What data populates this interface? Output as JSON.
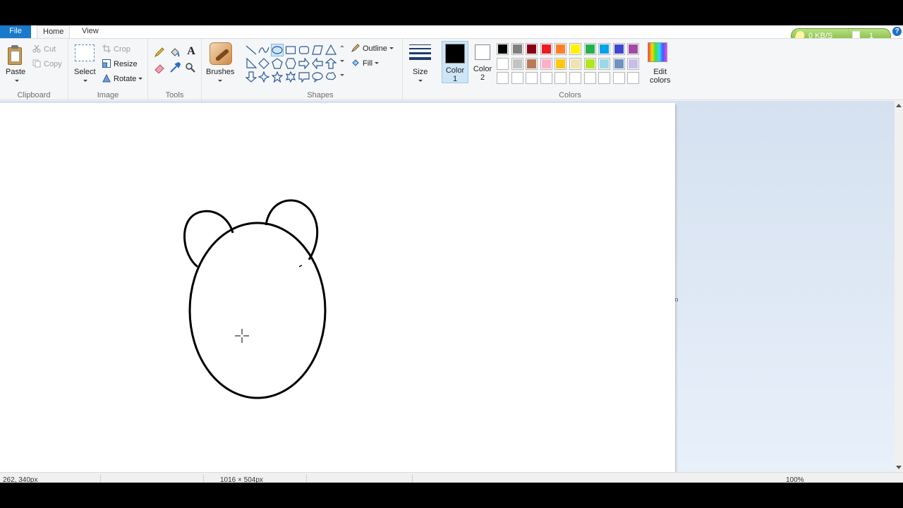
{
  "tabs": {
    "file": "File",
    "home": "Home",
    "view": "View"
  },
  "net_meter": {
    "speed": "0 KB/S",
    "count": "1"
  },
  "help": "?",
  "clipboard": {
    "paste": "Paste",
    "cut": "Cut",
    "copy": "Copy",
    "label": "Clipboard"
  },
  "image": {
    "select": "Select",
    "crop": "Crop",
    "resize": "Resize",
    "rotate": "Rotate",
    "label": "Image"
  },
  "tools": {
    "label": "Tools",
    "text_glyph": "A"
  },
  "brushes": {
    "label": "Brushes"
  },
  "shapes": {
    "outline": "Outline",
    "fill": "Fill",
    "label": "Shapes"
  },
  "size": {
    "label": "Size"
  },
  "colors": {
    "color1_label": "Color",
    "color1_num": "1",
    "color2_label": "Color",
    "color2_num": "2",
    "color1_value": "#000000",
    "color2_value": "#ffffff",
    "edit_label_1": "Edit",
    "edit_label_2": "colors",
    "label": "Colors",
    "palette_row1": [
      "#000000",
      "#7f7f7f",
      "#880015",
      "#ed1c24",
      "#ff7f27",
      "#fff200",
      "#22b14c",
      "#00a2e8",
      "#3f48cc",
      "#a349a4"
    ],
    "palette_row2": [
      "#ffffff",
      "#c3c3c3",
      "#b97a57",
      "#ffaec9",
      "#ffc90e",
      "#efe4b0",
      "#b5e61d",
      "#99d9ea",
      "#7092be",
      "#c8bfe7"
    ],
    "palette_row3": [
      "",
      "",
      "",
      "",
      "",
      "",
      "",
      "",
      "",
      ""
    ]
  },
  "status": {
    "cursor_pos": "262, 340px",
    "image_size": "1016 × 504px",
    "zoom": "100%"
  }
}
